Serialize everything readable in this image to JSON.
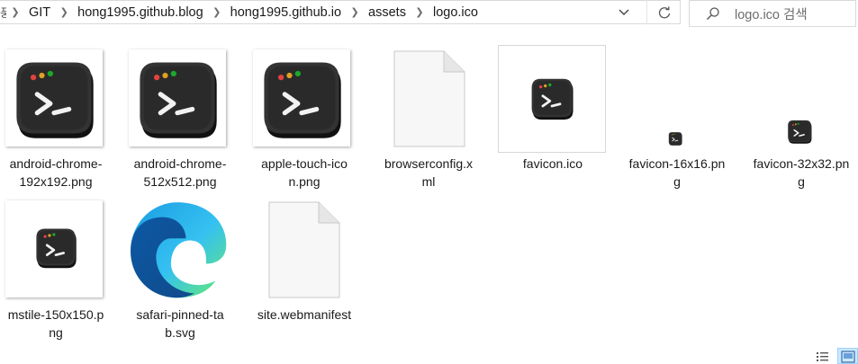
{
  "address": {
    "truncated": "풍",
    "crumbs": [
      "GIT",
      "hong1995.github.blog",
      "hong1995.github.io",
      "assets",
      "logo.ico"
    ]
  },
  "search": {
    "placeholder": "logo.ico 검색"
  },
  "files": [
    {
      "name": "android-chrome-192x192.png",
      "line1": "android-chrome-",
      "line2": "192x192.png",
      "icon": "terminal-logo-thumbnail"
    },
    {
      "name": "android-chrome-512x512.png",
      "line1": "android-chrome-",
      "line2": "512x512.png",
      "icon": "terminal-logo-thumbnail"
    },
    {
      "name": "apple-touch-icon.png",
      "line1": "apple-touch-ico",
      "line2": "n.png",
      "icon": "terminal-logo-thumbnail"
    },
    {
      "name": "browserconfig.xml",
      "line1": "browserconfig.x",
      "line2": "ml",
      "icon": "blank-document-icon"
    },
    {
      "name": "favicon.ico",
      "line1": "favicon.ico",
      "line2": "",
      "icon": "terminal-logo-thumbnail"
    },
    {
      "name": "favicon-16x16.png",
      "line1": "favicon-16x16.pn",
      "line2": "g",
      "icon": "terminal-logo-thumbnail"
    },
    {
      "name": "favicon-32x32.png",
      "line1": "favicon-32x32.pn",
      "line2": "g",
      "icon": "terminal-logo-thumbnail"
    },
    {
      "name": "mstile-150x150.png",
      "line1": "mstile-150x150.p",
      "line2": "ng",
      "icon": "terminal-logo-thumbnail"
    },
    {
      "name": "safari-pinned-tab.svg",
      "line1": "safari-pinned-ta",
      "line2": "b.svg",
      "icon": "edge-browser-icon"
    },
    {
      "name": "site.webmanifest",
      "line1": "site.webmanifest",
      "line2": "",
      "icon": "blank-document-icon"
    }
  ],
  "colors": {
    "logo_dark": "#2b2b2b",
    "logo_side": "#151515",
    "dot_red": "#e0443e",
    "dot_yellow": "#dea123",
    "dot_green": "#1aab29",
    "selected_view": "#cce8ff"
  }
}
